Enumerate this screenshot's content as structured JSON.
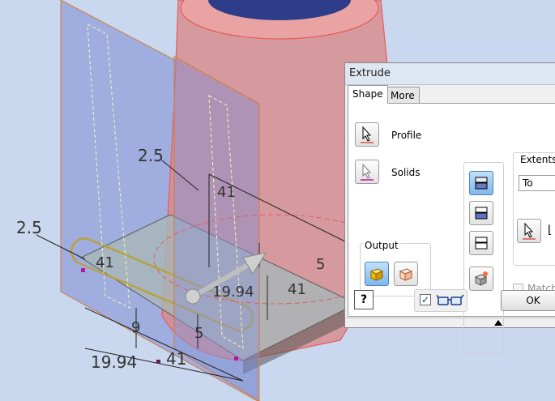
{
  "viewport": {
    "dimensions": [
      "2.5",
      "2.5",
      "41",
      "41",
      "41",
      "41",
      "5",
      "5",
      "9",
      "19.94",
      "19.94"
    ]
  },
  "dialog": {
    "title": "Extrude",
    "tabs": [
      {
        "label": "Shape",
        "active": true
      },
      {
        "label": "More",
        "active": false
      }
    ],
    "profile_label": "Profile",
    "solids_label": "Solids",
    "output_label": "Output",
    "extents_label": "Extents",
    "extents_value": "To",
    "match_label": "Match",
    "preview_checked": true,
    "ok_label": "OK",
    "help_label": "?"
  },
  "colors": {
    "accent": "#7fb8ea",
    "profile_underline": "#d9534f",
    "solids_underline": "#b5179e"
  }
}
